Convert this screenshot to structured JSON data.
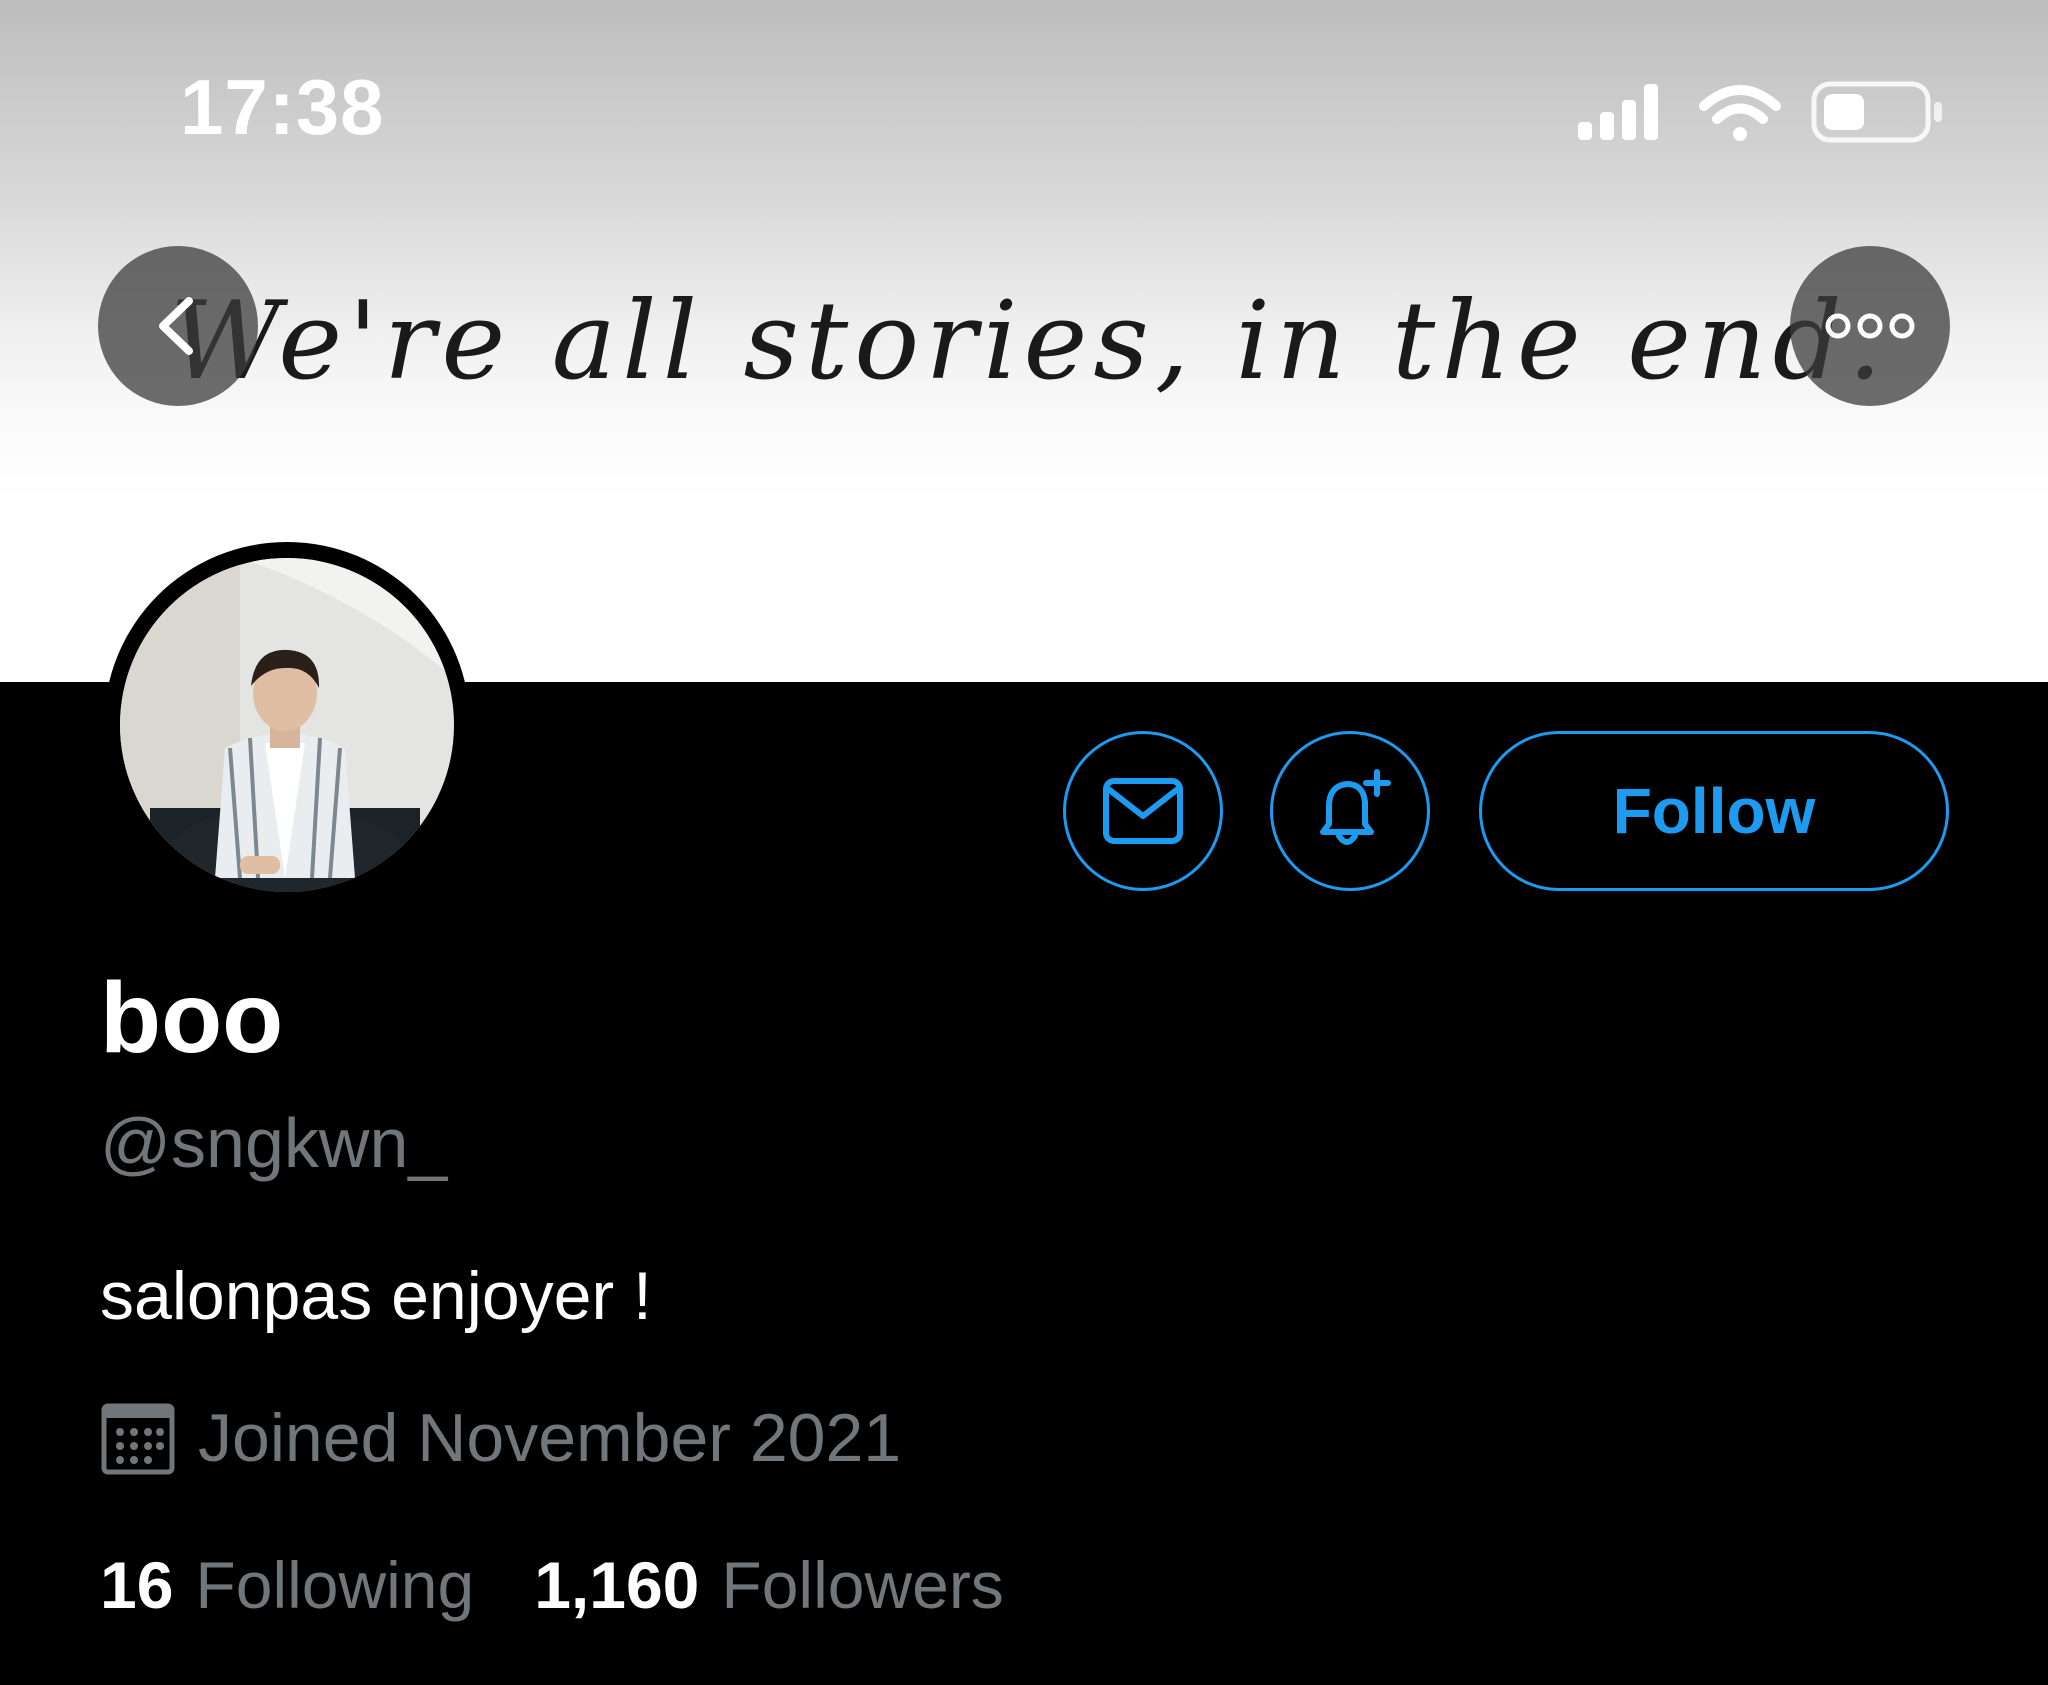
{
  "status_bar": {
    "time": "17:38"
  },
  "banner": {
    "quote": "We're all stories, in the end."
  },
  "profile": {
    "display_name": "boo",
    "handle": "@sngkwn_",
    "bio": "salonpas enjoyer !",
    "joined": "Joined November 2021"
  },
  "actions": {
    "follow_label": "Follow"
  },
  "stats": {
    "following_count": "16",
    "following_label": "Following",
    "followers_count": "1,160",
    "followers_label": "Followers"
  },
  "colors": {
    "accent": "#1d9bf0",
    "secondary_text": "#71767b",
    "background": "#000000"
  }
}
